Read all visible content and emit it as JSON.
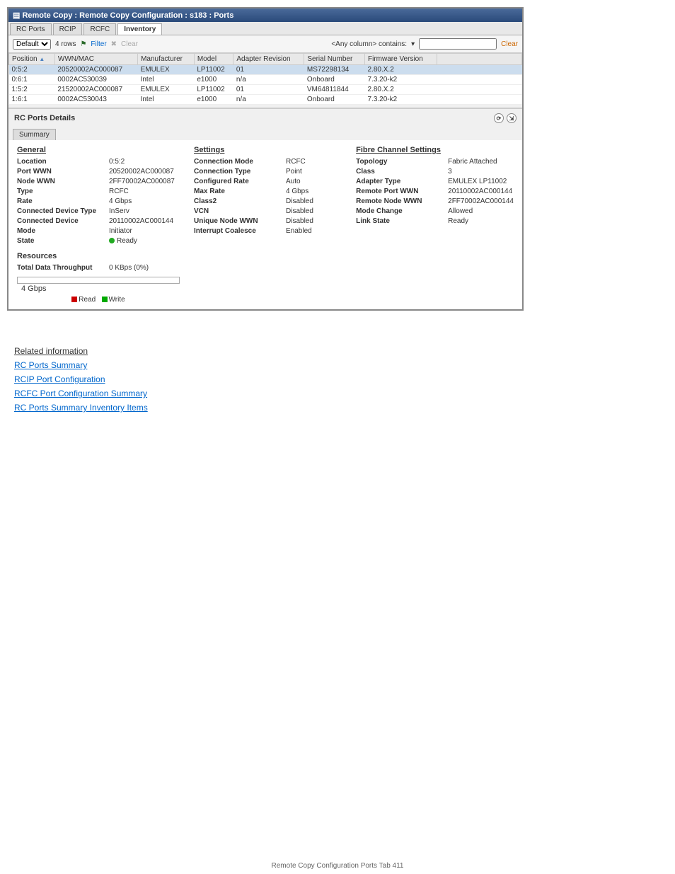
{
  "window": {
    "title": "Remote Copy : Remote Copy Configuration : s183 : Ports",
    "tabs": [
      "RC Ports",
      "RCIP",
      "RCFC",
      "Inventory"
    ],
    "active_tab": 3
  },
  "toolbar": {
    "view": "Default",
    "rowcount": "4 rows",
    "filter": "Filter",
    "clear": "Clear",
    "search_label": "<Any column> contains:",
    "search_value": "",
    "clear2": "Clear"
  },
  "grid": {
    "headers": [
      "Position",
      "WWN/MAC",
      "Manufacturer",
      "Model",
      "Adapter Revision",
      "Serial Number",
      "Firmware Version"
    ],
    "rows": [
      {
        "sel": true,
        "c": [
          "0:5:2",
          "20520002AC000087",
          "EMULEX",
          "LP11002",
          "01",
          "MS72298134",
          "2.80.X.2"
        ]
      },
      {
        "sel": false,
        "c": [
          "0:6:1",
          "0002AC530039",
          "Intel",
          "e1000",
          "n/a",
          "Onboard",
          "7.3.20-k2"
        ]
      },
      {
        "sel": false,
        "c": [
          "1:5:2",
          "21520002AC000087",
          "EMULEX",
          "LP11002",
          "01",
          "VM64811844",
          "2.80.X.2"
        ]
      },
      {
        "sel": false,
        "c": [
          "1:6:1",
          "0002AC530043",
          "Intel",
          "e1000",
          "n/a",
          "Onboard",
          "7.3.20-k2"
        ]
      }
    ]
  },
  "details_header": "RC Ports Details",
  "subtab": "Summary",
  "general": {
    "title": "General",
    "items": [
      {
        "k": "Location",
        "v": "0:5:2"
      },
      {
        "k": "Port WWN",
        "v": "20520002AC000087"
      },
      {
        "k": "Node WWN",
        "v": "2FF70002AC000087"
      },
      {
        "k": "Type",
        "v": "RCFC"
      },
      {
        "k": "Rate",
        "v": "4 Gbps"
      },
      {
        "k": "Connected Device Type",
        "v": "InServ"
      },
      {
        "k": "Connected Device",
        "v": "20110002AC000144"
      },
      {
        "k": "Mode",
        "v": "Initiator"
      },
      {
        "k": "State",
        "v": "Ready",
        "dot": true
      }
    ]
  },
  "resources": {
    "title": "Resources",
    "throughput_label": "Total Data Throughput",
    "throughput_value": "0 KBps (0%)",
    "scale": "4 Gbps",
    "legend_read": "Read",
    "legend_write": "Write"
  },
  "settings": {
    "title": "Settings",
    "items": [
      {
        "k": "Connection Mode",
        "v": "RCFC"
      },
      {
        "k": "Connection Type",
        "v": "Point"
      },
      {
        "k": "Configured Rate",
        "v": "Auto"
      },
      {
        "k": "Max Rate",
        "v": "4 Gbps"
      },
      {
        "k": "Class2",
        "v": "Disabled"
      },
      {
        "k": "VCN",
        "v": "Disabled"
      },
      {
        "k": "Unique Node WWN",
        "v": "Disabled"
      },
      {
        "k": "Interrupt Coalesce",
        "v": "Enabled"
      }
    ]
  },
  "fc": {
    "title": "Fibre Channel Settings",
    "items": [
      {
        "k": "Topology",
        "v": "Fabric Attached"
      },
      {
        "k": "Class",
        "v": "3"
      },
      {
        "k": "Adapter Type",
        "v": "EMULEX LP11002"
      },
      {
        "k": "Remote Port WWN",
        "v": "20110002AC000144"
      },
      {
        "k": "Remote Node WWN",
        "v": "2FF70002AC000144"
      },
      {
        "k": "Mode Change",
        "v": "Allowed"
      },
      {
        "k": "Link State",
        "v": "Ready"
      }
    ]
  },
  "post": {
    "related": "Related information",
    "links": [
      "RC Ports Summary",
      "RCIP Port Configuration",
      "RCFC Port Configuration Summary",
      "RC Ports Summary Inventory Items"
    ]
  },
  "footer": {
    "text": "Remote Copy Configuration Ports Tab    411"
  }
}
